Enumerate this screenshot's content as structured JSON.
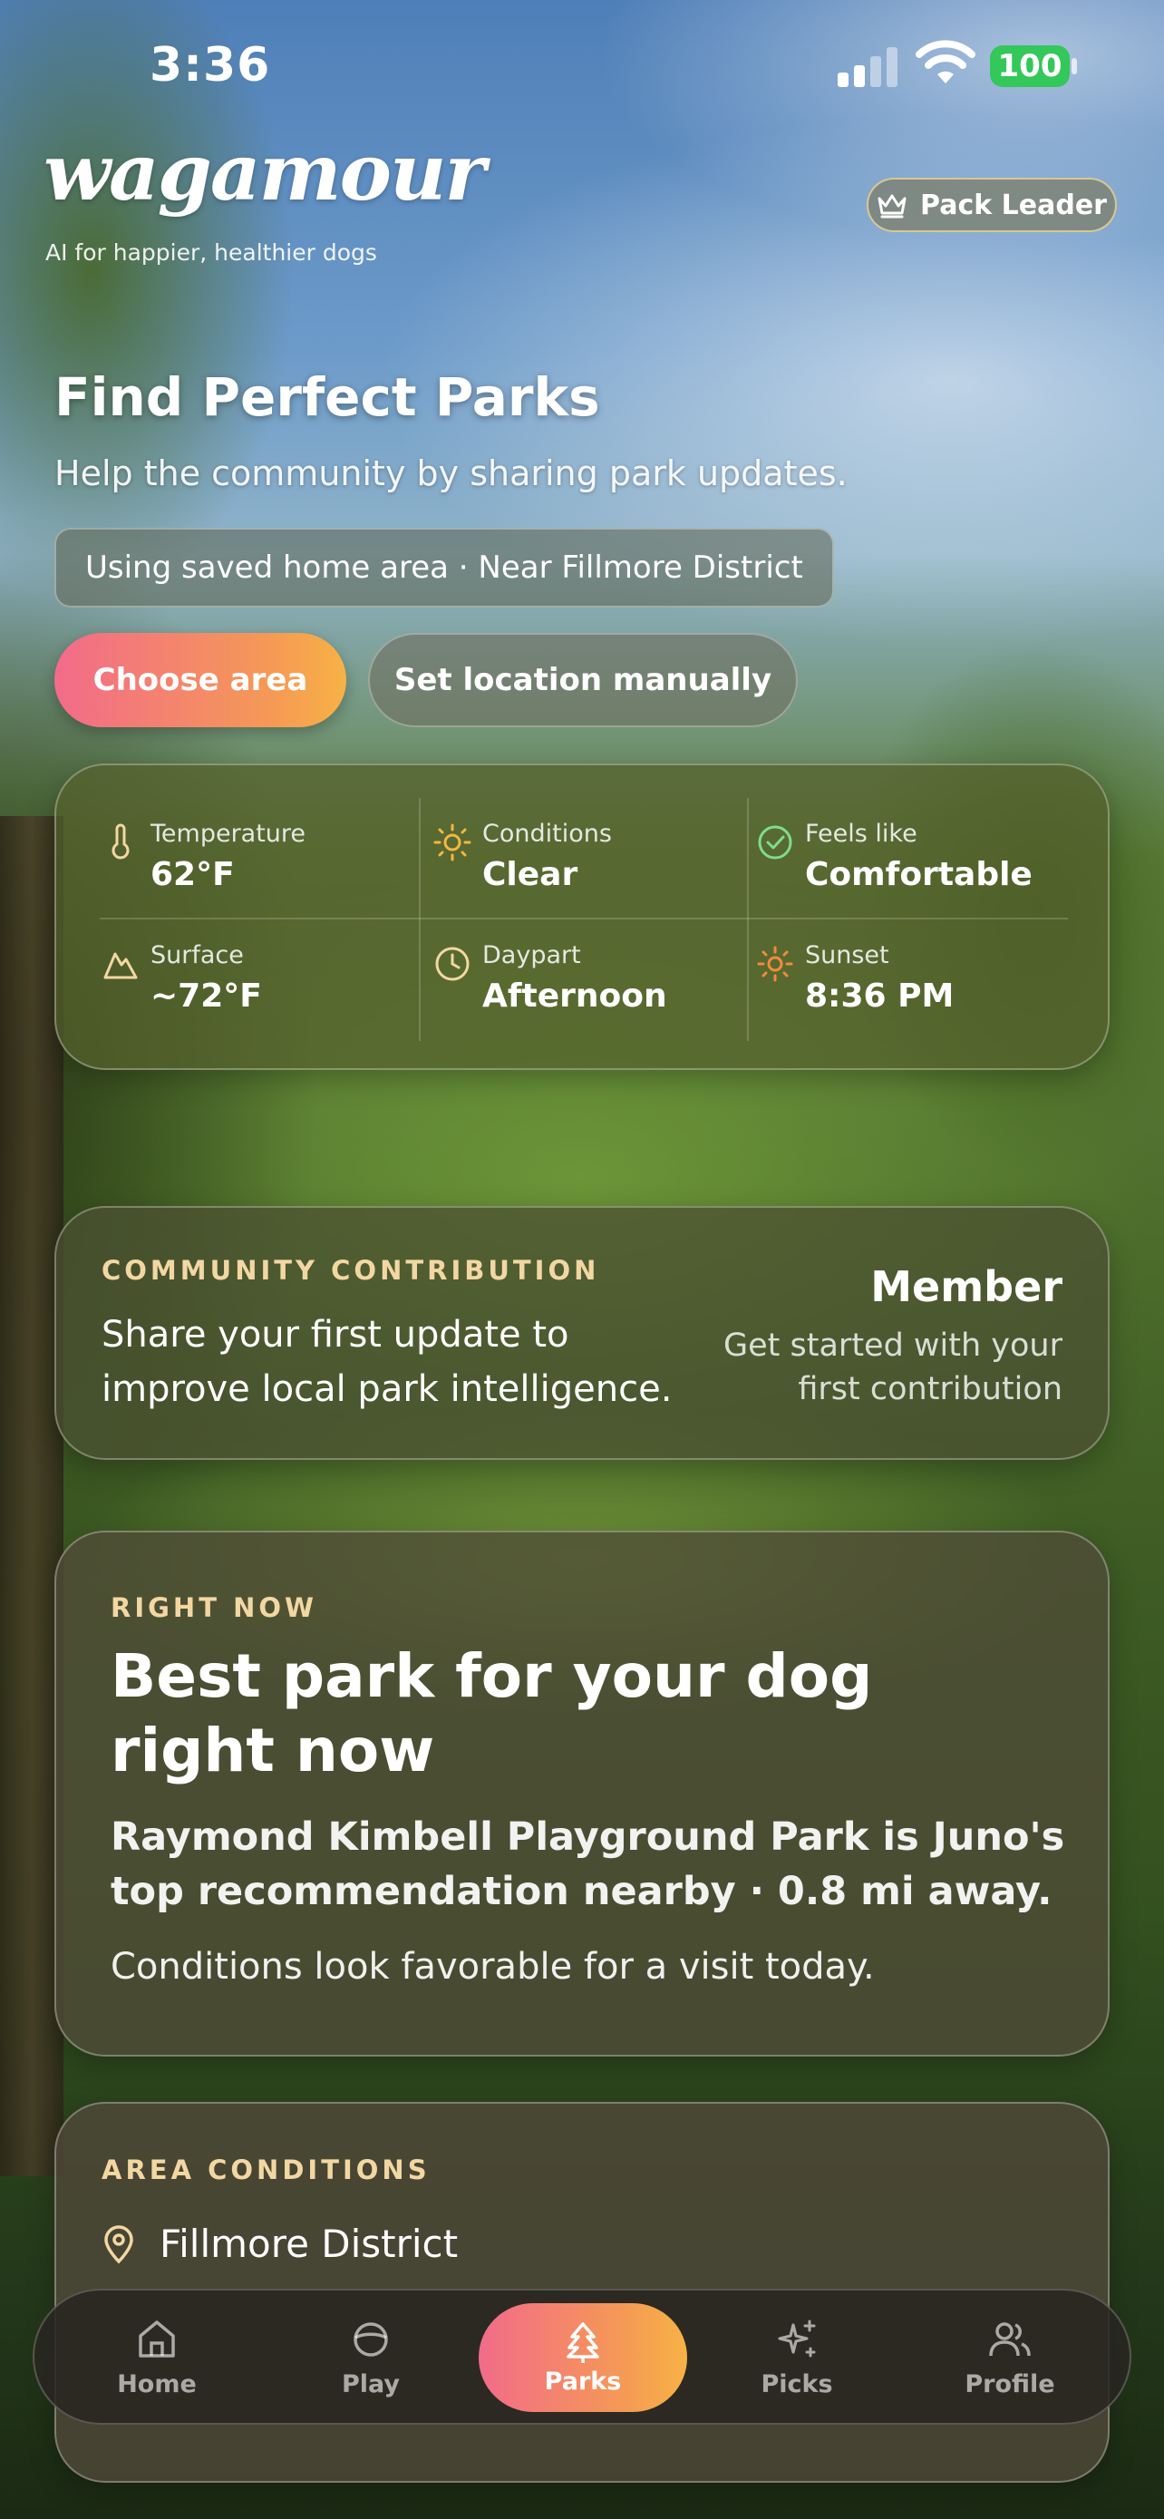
{
  "status_bar": {
    "time": "3:36",
    "battery": "100"
  },
  "brand": {
    "logo": "wagamour",
    "tagline": "AI for happier, healthier dogs",
    "badge_label": "Pack Leader",
    "badge_icon": "crown-icon"
  },
  "header": {
    "title": "Find Perfect Parks",
    "subtitle": "Help the community by sharing park updates.",
    "location_text": "Using saved home area · Near Fillmore District",
    "choose_area_label": "Choose area",
    "manual_location_label": "Set location manually"
  },
  "weather": [
    {
      "label": "Temperature",
      "value": "62°F",
      "icon": "thermometer-icon"
    },
    {
      "label": "Conditions",
      "value": "Clear",
      "icon": "sun-icon"
    },
    {
      "label": "Feels like",
      "value": "Comfortable",
      "icon": "check-circle-icon"
    },
    {
      "label": "Surface",
      "value": "~72°F",
      "icon": "mountain-icon"
    },
    {
      "label": "Daypart",
      "value": "Afternoon",
      "icon": "clock-icon"
    },
    {
      "label": "Sunset",
      "value": "8:36 PM",
      "icon": "sunset-icon"
    }
  ],
  "community": {
    "eyebrow": "COMMUNITY CONTRIBUTION",
    "text": "Share your first update to improve local park intelligence.",
    "level": "Member",
    "level_sub": "Get started with your first contribution"
  },
  "right_now": {
    "eyebrow": "RIGHT NOW",
    "title": "Best park for your dog right now",
    "body": "Raymond Kimbell Playground Park is Juno's top recommendation nearby · 0.8 mi away.",
    "note": "Conditions look favorable for a visit today."
  },
  "area_conditions": {
    "eyebrow": "AREA CONDITIONS",
    "place": "Fillmore District"
  },
  "tabs": [
    {
      "label": "Home",
      "icon": "home-icon"
    },
    {
      "label": "Play",
      "icon": "ball-icon"
    },
    {
      "label": "Parks",
      "icon": "tree-icon",
      "active": true
    },
    {
      "label": "Picks",
      "icon": "sparkles-icon"
    },
    {
      "label": "Profile",
      "icon": "users-icon"
    }
  ],
  "colors": {
    "accent_start": "#f26b8a",
    "accent_end": "#f7b245",
    "eyebrow": "#f3d7a3",
    "battery": "#34c759"
  }
}
